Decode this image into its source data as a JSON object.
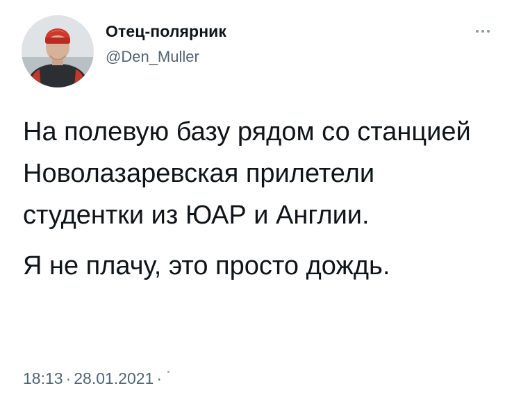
{
  "author": {
    "display_name": "Отец-полярник",
    "handle": "@Den_Muller"
  },
  "tweet": {
    "paragraph_1": "На полевую базу рядом со станцией Новолазаревская прилетели студентки из ЮАР и Англии.",
    "paragraph_2": "Я не плачу, это просто дождь."
  },
  "meta": {
    "time": "18:13",
    "separator": "·",
    "date": "28.01.2021"
  },
  "icons": {
    "more": "more-horizontal-icon"
  },
  "colors": {
    "text_primary": "#0f1419",
    "text_secondary": "#536471",
    "hat_red": "#d2362b"
  }
}
